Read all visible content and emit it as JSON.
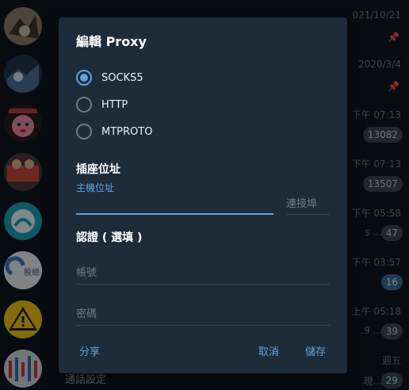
{
  "dialog": {
    "title": "編輯 Proxy",
    "proxy_types": [
      {
        "label": "SOCKS5",
        "selected": true
      },
      {
        "label": "HTTP",
        "selected": false
      },
      {
        "label": "MTPROTO",
        "selected": false
      }
    ],
    "socket_section_title": "插座位址",
    "host_label": "主機位址",
    "host_value": "",
    "port_placeholder": "連接埠",
    "auth_section_title": "認證 ( 選填 )",
    "username_placeholder": "帳號",
    "password_placeholder": "密碼",
    "share_button": "分享",
    "cancel_button": "取消",
    "save_button": "儲存"
  },
  "chat_list": {
    "rows": [
      {
        "time": "021/10/21",
        "pinned": true
      },
      {
        "time": "2020/3/4",
        "pinned": true
      },
      {
        "time": "下午 07:13",
        "badge": "13082"
      },
      {
        "time": "下午 07:13",
        "badge": "13507"
      },
      {
        "time": "下午 05:58",
        "snippet": "s ...",
        "badge": "47"
      },
      {
        "time": "下午 03:57",
        "badge": "16",
        "badge_unmuted": true
      },
      {
        "time": "上午 05:18",
        "snippet": ".9 ...",
        "badge": "39"
      },
      {
        "time": "週五",
        "snippet": "現...",
        "badge": "29"
      }
    ],
    "bottom_label": "通話設定",
    "avatar_2_text": "股總"
  },
  "colors": {
    "accent": "#5fa3de",
    "dialog_bg": "#1e2c3a",
    "app_bg": "#0f171f",
    "badge_muted": "#3a4856",
    "badge_unmuted": "#3a6d9a"
  }
}
